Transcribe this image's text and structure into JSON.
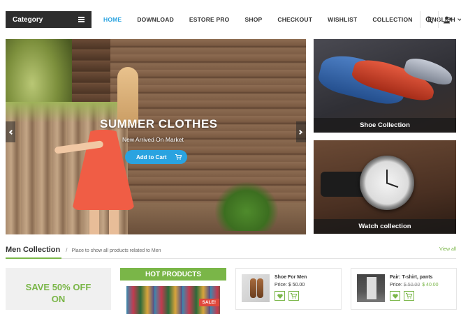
{
  "header": {
    "category_label": "Category",
    "nav": [
      {
        "label": "HOME",
        "active": true
      },
      {
        "label": "DOWNLOAD"
      },
      {
        "label": "ESTORE PRO"
      },
      {
        "label": "SHOP"
      },
      {
        "label": "CHECKOUT"
      },
      {
        "label": "WISHLIST"
      },
      {
        "label": "COLLECTION"
      }
    ],
    "language": "ENGLISH",
    "icons": [
      "search-icon",
      "user-icon"
    ]
  },
  "slider": {
    "title": "SUMMER CLOTHES",
    "subtitle": "New Arrived On Market",
    "cta_label": "Add to Cart"
  },
  "banners": [
    {
      "caption": "Shoe Collection"
    },
    {
      "caption": "Watch collection"
    }
  ],
  "section": {
    "title": "Men Collection",
    "separator": "/",
    "subtitle": "Place to show all products related to Men",
    "view_all": "View all"
  },
  "promo": {
    "line1": "SAVE 50% OFF",
    "line2": "ON"
  },
  "hot_products": {
    "title": "HOT PRODUCTS",
    "badge": "SALE!"
  },
  "products": [
    {
      "name": "Shoe For Men",
      "price_label": "Price:",
      "price": "$ 50.00",
      "old_price": ""
    },
    {
      "name": "Pair: T-shirt, pants",
      "price_label": "Price:",
      "price": "$ 40.00",
      "old_price": "$ 50.00"
    }
  ],
  "colors": {
    "accent_blue": "#2aa3e0",
    "accent_green": "#7ab648",
    "dark": "#2d2d2d"
  }
}
